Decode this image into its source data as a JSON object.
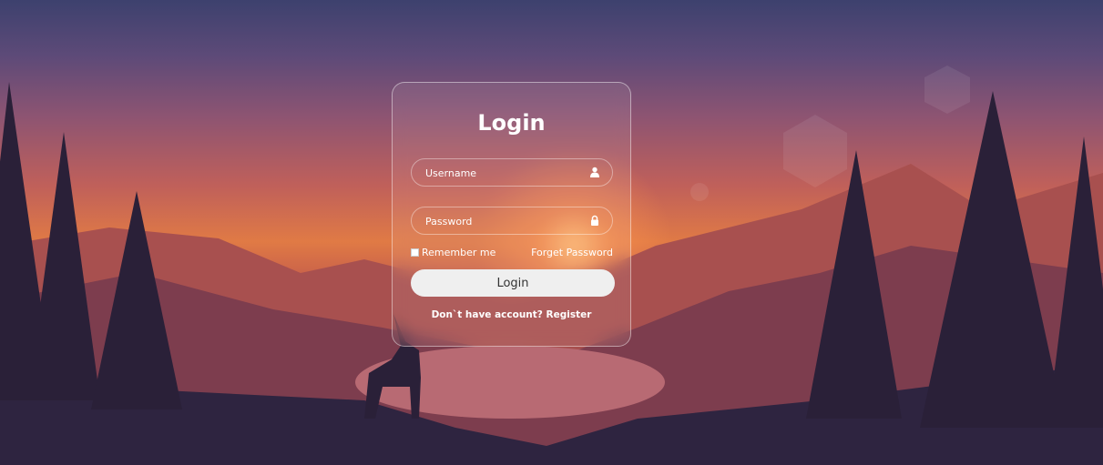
{
  "login": {
    "title": "Login",
    "username_placeholder": "Username",
    "username_icon": "user-icon",
    "password_placeholder": "Password",
    "password_icon": "lock-icon",
    "remember_label": "Remember me",
    "forgot_link": "Forget Password",
    "submit_label": "Login",
    "register_prompt": "Don`t have account?",
    "register_link": "Register"
  },
  "colors": {
    "sky_top": "#3d416e",
    "sunset": "#e07a45",
    "silhouette": "#2a2038",
    "button": "#efefef"
  }
}
